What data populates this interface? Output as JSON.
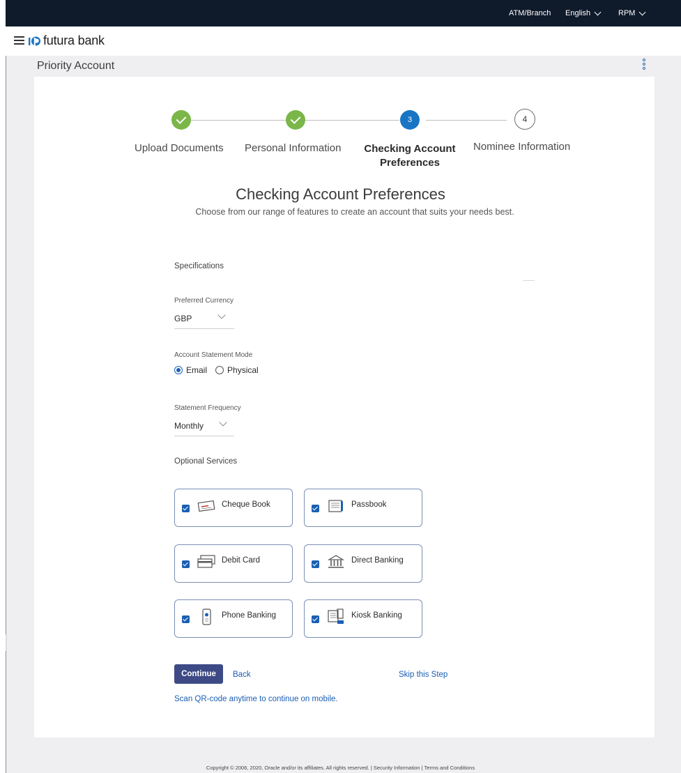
{
  "topbar": {
    "atm_branch": "ATM/Branch",
    "language": "English",
    "user": "RPM"
  },
  "brand": {
    "name": "futura bank"
  },
  "page": {
    "title": "Priority Account"
  },
  "stepper": {
    "steps": [
      {
        "label": "Upload Documents",
        "state": "done"
      },
      {
        "label": "Personal Information",
        "state": "done"
      },
      {
        "label": "Checking Account Preferences",
        "number": "3",
        "state": "current"
      },
      {
        "label": "Nominee Information",
        "number": "4",
        "state": "pending"
      }
    ]
  },
  "section": {
    "heading": "Checking Account Preferences",
    "subheading": "Choose from our range of features to create an account that suits your needs best."
  },
  "specifications": {
    "title": "Specifications",
    "currency": {
      "label": "Preferred Currency",
      "value": "GBP"
    },
    "statement_mode": {
      "label": "Account Statement Mode",
      "options": [
        "Email",
        "Physical"
      ],
      "selected": "Email"
    },
    "frequency": {
      "label": "Statement Frequency",
      "value": "Monthly"
    }
  },
  "optional_services": {
    "title": "Optional Services",
    "items": [
      {
        "label": "Cheque Book",
        "checked": true,
        "icon": "cheque-book-icon"
      },
      {
        "label": "Passbook",
        "checked": true,
        "icon": "passbook-icon"
      },
      {
        "label": "Debit Card",
        "checked": true,
        "icon": "debit-card-icon"
      },
      {
        "label": "Direct Banking",
        "checked": true,
        "icon": "bank-building-icon"
      },
      {
        "label": "Phone Banking",
        "checked": true,
        "icon": "phone-icon"
      },
      {
        "label": "Kiosk Banking",
        "checked": true,
        "icon": "kiosk-icon"
      }
    ]
  },
  "actions": {
    "continue": "Continue",
    "back": "Back",
    "skip": "Skip this Step",
    "qr_link": "Scan QR-code anytime to continue on mobile."
  },
  "footer": {
    "text": "Copyright © 2006, 2020, Oracle and/or its affiliates. All rights reserved. | Security Information | Terms and Conditions"
  },
  "colors": {
    "topbar": "#0f1a2b",
    "step_done": "#7ab648",
    "step_current": "#1a74c4",
    "primary_button": "#3e4a86",
    "link": "#1a5fb4"
  }
}
